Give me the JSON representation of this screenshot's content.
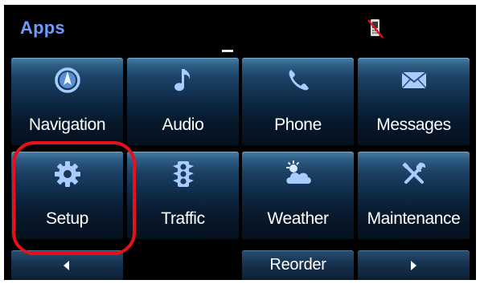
{
  "header": {
    "title": "Apps",
    "status_icon": "phone-disconnected-icon"
  },
  "colors": {
    "header_title": "#6f9bff",
    "highlight_ring": "#e8111a",
    "icon_blue": "#a9ccff"
  },
  "apps": [
    {
      "label": "Navigation",
      "icon": "navigation-compass-icon"
    },
    {
      "label": "Audio",
      "icon": "music-note-icon"
    },
    {
      "label": "Phone",
      "icon": "phone-handset-icon"
    },
    {
      "label": "Messages",
      "icon": "envelope-icon"
    },
    {
      "label": "Setup",
      "icon": "gear-icon"
    },
    {
      "label": "Traffic",
      "icon": "traffic-light-icon"
    },
    {
      "label": "Weather",
      "icon": "weather-cloud-sun-icon"
    },
    {
      "label": "Maintenance",
      "icon": "wrench-screwdriver-icon"
    }
  ],
  "footer": {
    "prev_icon": "arrow-left-icon",
    "reorder_label": "Reorder",
    "next_icon": "arrow-right-icon"
  }
}
